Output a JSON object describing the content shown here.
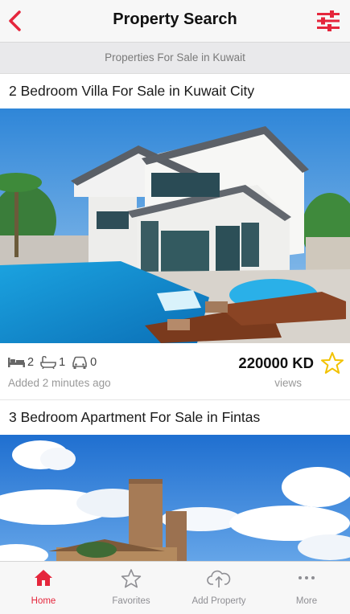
{
  "app": {
    "accent": "#e5263c"
  },
  "navbar": {
    "title": "Property Search",
    "back_icon": "chevron-left-icon",
    "filter_icon": "sliders-icon"
  },
  "subheader": {
    "text": "Properties For Sale in Kuwait"
  },
  "listings": [
    {
      "title": "2 Bedroom Villa For Sale in Kuwait City",
      "photo": "villa-with-pool-photo",
      "bedrooms": "2",
      "bathrooms": "1",
      "parking": "0",
      "added": "Added 2 minutes ago",
      "price": "220000 KD",
      "views": "views"
    },
    {
      "title": "3 Bedroom Apartment For Sale in Fintas",
      "photo": "building-under-sky-photo"
    }
  ],
  "tabbar": {
    "tabs": [
      {
        "label": "Home",
        "icon": "home-icon",
        "active": true
      },
      {
        "label": "Favorites",
        "icon": "star-icon",
        "active": false
      },
      {
        "label": "Add Property",
        "icon": "cloud-upload-icon",
        "active": false
      },
      {
        "label": "More",
        "icon": "more-dots-icon",
        "active": false
      }
    ]
  }
}
